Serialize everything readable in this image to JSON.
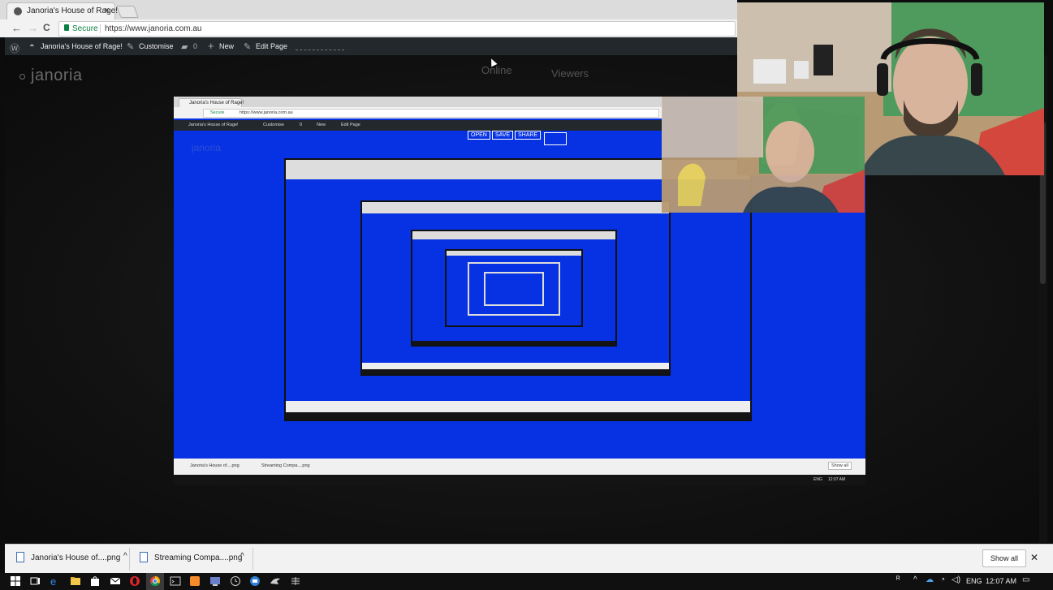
{
  "browser": {
    "tab_title": "Janoria's House of Rage!",
    "tab_close": "×",
    "back": "←",
    "forward": "→",
    "reload": "C",
    "secure_label": "Secure",
    "url": "https://www.janoria.com.au"
  },
  "admin_bar": {
    "site_name": "Janoria's House of Rage!",
    "customise": "Customise",
    "comments_count": "0",
    "new": "New",
    "edit_page": "Edit Page"
  },
  "site": {
    "logo": "janoria",
    "nav_online": "Online",
    "nav_viewers": "Viewers"
  },
  "nested": {
    "tab_title": "Janoria's House of Rage!",
    "url": "https://www.janoria.com.au",
    "secure_label": "Secure",
    "logo": "janoria",
    "buttons": [
      "OPEN",
      "SAVE",
      "SHARE"
    ],
    "admin_items": [
      "Janoria's House of Rage!",
      "Customise",
      "0",
      "New",
      "Edit Page"
    ],
    "downloads": [
      "Janoria's House of....png",
      "Streaming Compa....png"
    ],
    "show_all": "Show all",
    "tray_lang": "ENG",
    "tray_time": "12:07 AM"
  },
  "downloads": {
    "items": [
      {
        "name": "Janoria's House of....png"
      },
      {
        "name": "Streaming Compa....png"
      }
    ],
    "show_all": "Show all",
    "close": "✕"
  },
  "taskbar": {
    "lang": "ENG",
    "time": "12:07 AM",
    "icons": [
      "windows-start",
      "task-view",
      "edge",
      "file-explorer",
      "store",
      "mail",
      "opera",
      "chrome",
      "terminal",
      "sublime",
      "screen-recorder",
      "clock",
      "onedrive",
      "game",
      "tool"
    ]
  },
  "colors": {
    "site_blue": "#0632e3",
    "admin_bar": "#23282d",
    "secure_green": "#0b8043"
  }
}
